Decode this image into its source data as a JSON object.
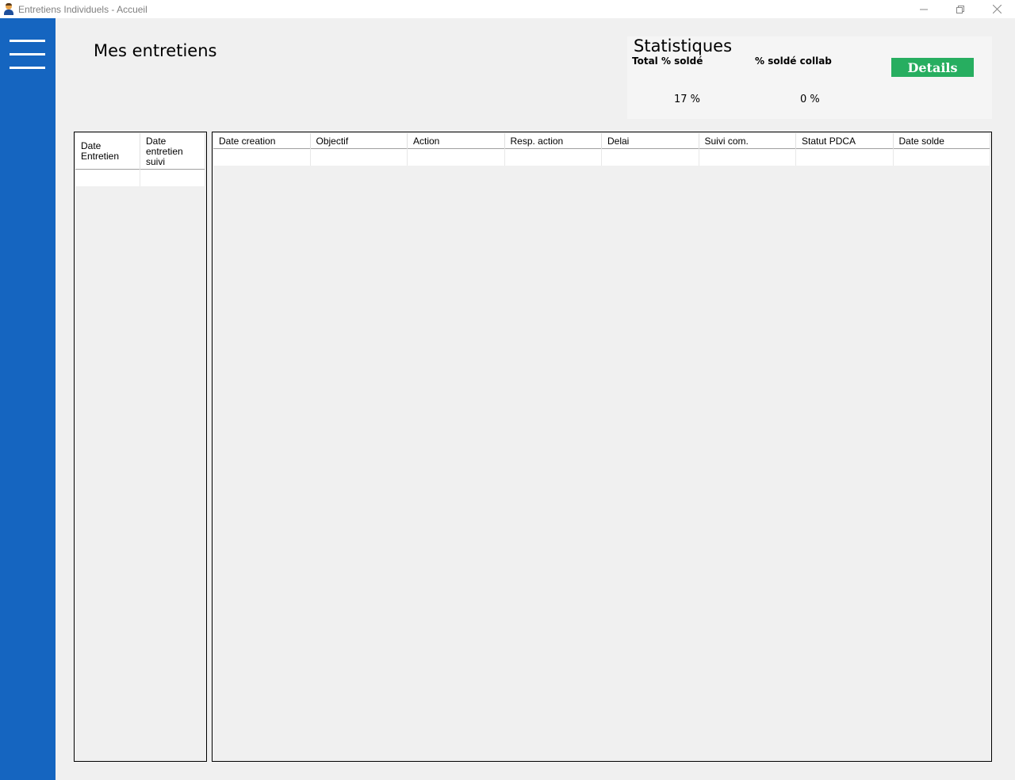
{
  "window": {
    "title": "Entretiens Individuels - Accueil",
    "icon": "user-icon",
    "controls": [
      "minimize-icon",
      "restore-icon",
      "close-icon"
    ]
  },
  "sidebar": {
    "menu_icon": "hamburger-menu-icon",
    "color": "#1565c0"
  },
  "page_title": "Mes entretiens",
  "stats": {
    "title": "Statistiques",
    "total_label": "Total % soldé",
    "total_value": "17 %",
    "collab_label": "% soldé collab",
    "collab_value": "0 %",
    "details_label": "Details",
    "details_color": "#27ae60"
  },
  "left_grid": {
    "columns": [
      "Date\nEntretien",
      "Date\nentretien\nsuivi"
    ],
    "rows": [
      [
        "",
        ""
      ]
    ]
  },
  "main_grid": {
    "columns": [
      "Date creation",
      "Objectif",
      "Action",
      "Resp. action",
      "Delai",
      "Suivi com.",
      "Statut PDCA",
      "Date solde"
    ],
    "rows": [
      [
        "",
        "",
        "",
        "",
        "",
        "",
        "",
        ""
      ]
    ]
  }
}
